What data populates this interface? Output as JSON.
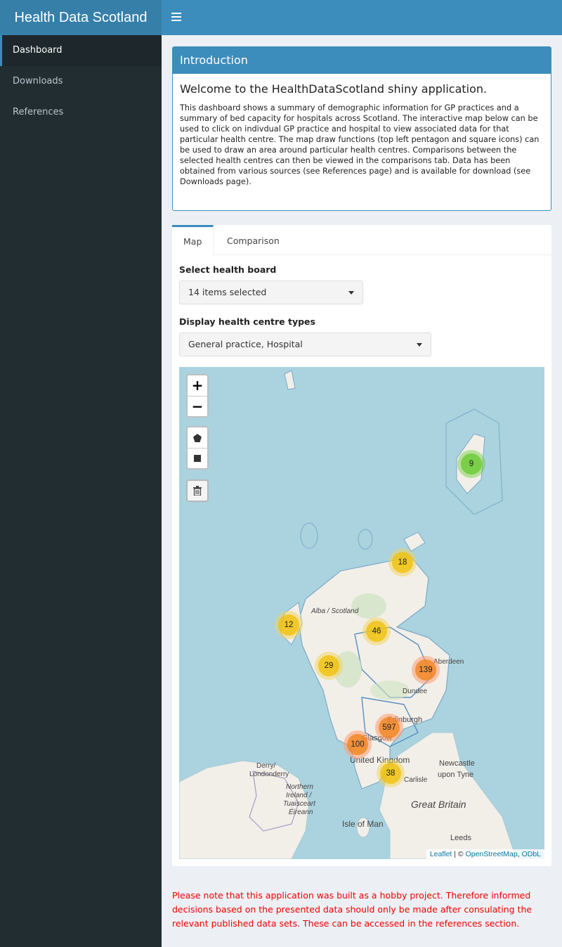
{
  "app": {
    "title": "Health Data Scotland"
  },
  "sidebar": {
    "items": [
      {
        "label": "Dashboard"
      },
      {
        "label": "Downloads"
      },
      {
        "label": "References"
      }
    ]
  },
  "intro": {
    "header": "Introduction",
    "title": "Welcome to the HealthDataScotland shiny application.",
    "body": "This dashboard shows a summary of demographic information for GP practices and a summary of bed capacity for hospitals across Scotland. The interactive map below can be used to click on indivdual GP practice and hospital to view associated data for that particular health centre. The map draw functions (top left pentagon and square icons) can be used to draw an area around particular health centres. Comparisons between the selected health centres can then be viewed in the comparisons tab. Data has been obtained from various sources (see References page) and is available for download (see Downloads page)."
  },
  "tabs": [
    {
      "label": "Map"
    },
    {
      "label": "Comparison"
    }
  ],
  "filters": {
    "health_board": {
      "label": "Select health board",
      "value": "14 items selected"
    },
    "centre_types": {
      "label": "Display health centre types",
      "value": "General practice, Hospital"
    }
  },
  "map": {
    "zoom_in": "+",
    "zoom_out": "−",
    "clusters": [
      "9",
      "18",
      "12",
      "46",
      "29",
      "139",
      "597",
      "100",
      "38"
    ],
    "labels": [
      "Alba / Scotland",
      "Aberdeen",
      "Dundee",
      "Edinburgh",
      "Glasgow",
      "United Kingdom",
      "Newcastle",
      "upon Tyne",
      "Carlisle",
      "Derry/",
      "Londonderry",
      "Northern",
      "Ireland /",
      "Tuaisceart",
      "Éireann",
      "Great Britain",
      "Isle of Man",
      "Leeds"
    ],
    "attribution": {
      "leaflet": "Leaflet",
      "separator": " | © ",
      "osm": "OpenStreetMap",
      "comma": ", ",
      "odbl": "ODbL"
    }
  },
  "disclaimer": "Please note that this application was built as a hobby project. Therefore informed decisions based on the presented data should only be made after consulating the relevant published data sets. These can be accessed in the references section.",
  "colors": {
    "header": "#3c8dbc",
    "logo": "#367fa9",
    "sidebar": "#222d32",
    "sea": "#aad3df",
    "land": "#f2efe9",
    "disclaimer": "#ee0000"
  }
}
